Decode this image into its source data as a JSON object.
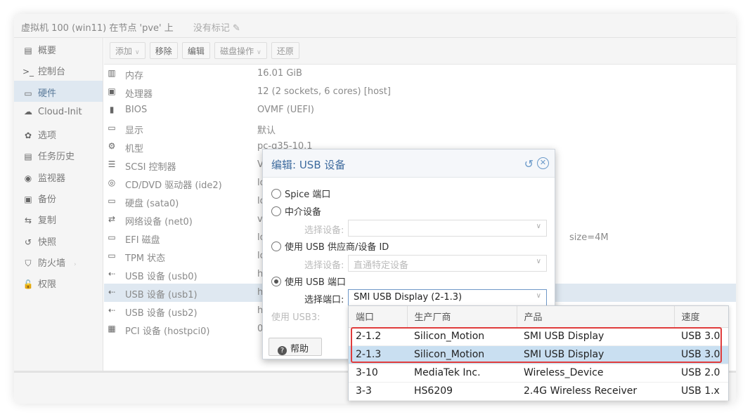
{
  "window": {
    "title": "虚拟机 100 (win11) 在节点 'pve' 上",
    "tags_label": "没有标记"
  },
  "sidebar": {
    "items": [
      {
        "label": "概要",
        "icon": "book-icon",
        "glyph": "▤"
      },
      {
        "label": "控制台",
        "icon": "terminal-icon",
        "glyph": ">_"
      },
      {
        "label": "硬件",
        "icon": "monitor-icon",
        "glyph": "▭",
        "active": true
      },
      {
        "label": "Cloud-Init",
        "icon": "cloud-icon",
        "glyph": "☁"
      },
      {
        "label": "选项",
        "icon": "gear-icon",
        "glyph": "✿"
      },
      {
        "label": "任务历史",
        "icon": "list-icon",
        "glyph": "▤"
      },
      {
        "label": "监视器",
        "icon": "eye-icon",
        "glyph": "◉"
      },
      {
        "label": "备份",
        "icon": "floppy-icon",
        "glyph": "▣"
      },
      {
        "label": "复制",
        "icon": "retweet-icon",
        "glyph": "⇆"
      },
      {
        "label": "快照",
        "icon": "history-icon",
        "glyph": "↺"
      },
      {
        "label": "防火墙",
        "icon": "shield-icon",
        "glyph": "⛉",
        "arrow": "›"
      },
      {
        "label": "权限",
        "icon": "unlock-icon",
        "glyph": "🔓"
      }
    ]
  },
  "toolbar": {
    "add": "添加",
    "remove": "移除",
    "edit": "编辑",
    "disk_ops": "磁盘操作",
    "revert": "还原"
  },
  "hardware": [
    {
      "name": "内存",
      "value": "16.01 GiB",
      "icon": "memory-icon",
      "glyph": "▥"
    },
    {
      "name": "处理器",
      "value": "12 (2 sockets, 6 cores) [host]",
      "icon": "cpu-icon",
      "glyph": "▣"
    },
    {
      "name": "BIOS",
      "value": "OVMF (UEFI)",
      "icon": "chip-icon",
      "glyph": "▮"
    },
    {
      "name": "显示",
      "value": "默认",
      "icon": "desktop-icon",
      "glyph": "▭"
    },
    {
      "name": "机型",
      "value": "pc-q35-10.1",
      "icon": "cogs-icon",
      "glyph": "⚙"
    },
    {
      "name": "SCSI 控制器",
      "value": "V",
      "icon": "database-icon",
      "glyph": "☰"
    },
    {
      "name": "CD/DVD 驱动器 (ide2)",
      "value": "lo",
      "icon": "cdrom-icon",
      "glyph": "◎"
    },
    {
      "name": "硬盘 (sata0)",
      "value": "lo",
      "icon": "hdd-icon",
      "glyph": "▭"
    },
    {
      "name": "网络设备 (net0)",
      "value": "v",
      "icon": "exchange-icon",
      "glyph": "⇄"
    },
    {
      "name": "EFI 磁盘",
      "value": "lo",
      "value_tail": "size=4M",
      "icon": "hdd-icon",
      "glyph": "▭"
    },
    {
      "name": "TPM 状态",
      "value": "lo",
      "icon": "hdd-icon",
      "glyph": "▭"
    },
    {
      "name": "USB 设备 (usb0)",
      "value": "h",
      "icon": "usb-icon",
      "glyph": "⇠"
    },
    {
      "name": "USB 设备 (usb1)",
      "value": "h",
      "icon": "usb-icon",
      "glyph": "⇠",
      "selected": true
    },
    {
      "name": "USB 设备 (usb2)",
      "value": "h",
      "icon": "usb-icon",
      "glyph": "⇠"
    },
    {
      "name": "PCI 设备 (hostpci0)",
      "value": "0",
      "icon": "pci-icon",
      "glyph": "▦"
    }
  ],
  "dialog": {
    "title": "编辑: USB 设备",
    "options": {
      "spice": "Spice 端口",
      "mapped": "中介设备",
      "vendor": "使用 USB 供应商/设备 ID",
      "port": "使用 USB 端口"
    },
    "select_device_label": "选择设备:",
    "select_device_placeholder": "直通特定设备",
    "select_port_label": "选择端口:",
    "select_port_value": "SMI USB Display (2-1.3)",
    "usb3_label": "使用 USB3:",
    "help": "帮助"
  },
  "port_dropdown": {
    "columns": [
      "端口",
      "生产厂商",
      "产品",
      "速度"
    ],
    "rows": [
      {
        "port": "2-1.2",
        "vendor": "Silicon_Motion",
        "product": "SMI USB Display",
        "speed": "USB 3.0"
      },
      {
        "port": "2-1.3",
        "vendor": "Silicon_Motion",
        "product": "SMI USB Display",
        "speed": "USB 3.0",
        "highlight": true
      },
      {
        "port": "3-10",
        "vendor": "MediaTek Inc.",
        "product": "Wireless_Device",
        "speed": "USB 2.0"
      },
      {
        "port": "3-3",
        "vendor": "HS6209",
        "product": "2.4G Wireless Receiver",
        "speed": "USB 1.x"
      }
    ]
  },
  "colors": {
    "accent": "#3e6b9e",
    "selected_bg": "#dfe8f1",
    "highlight_row": "#c9dff1",
    "annotation_red": "#e03c3c"
  }
}
